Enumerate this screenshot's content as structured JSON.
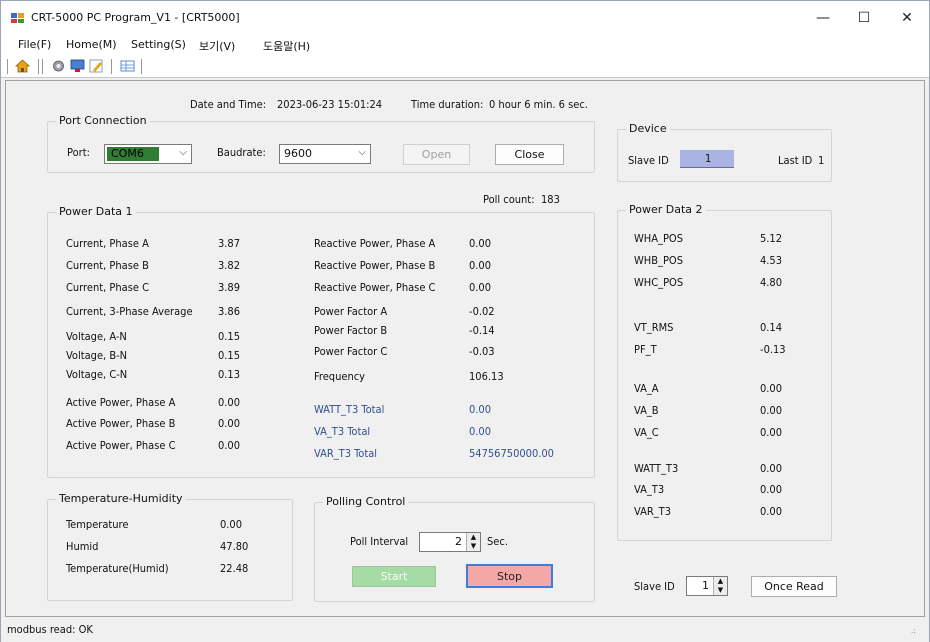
{
  "window": {
    "title": "CRT-5000 PC Program_V1 - [CRT5000]",
    "minimize": "—",
    "maximize": "☐",
    "close": "✕"
  },
  "menu": [
    "File(F)",
    "Home(M)",
    "Setting(S)",
    "보기(V)",
    "도움말(H)"
  ],
  "toolbar": {
    "icons": [
      "home-icon",
      "gear-icon",
      "monitor-icon",
      "edit-icon",
      "table-icon"
    ]
  },
  "header": {
    "datetime_label": "Date and Time:",
    "datetime_value": "2023-06-23 15:01:24",
    "duration_label": "Time duration:",
    "duration_value": "0 hour 6 min. 6 sec."
  },
  "port": {
    "group_title": "Port Connection",
    "port_label": "Port:",
    "port_value": "COM6",
    "baud_label": "Baudrate:",
    "baud_value": "9600",
    "open_label": "Open",
    "close_label": "Close"
  },
  "poll_count": {
    "label": "Poll count:",
    "value": "183"
  },
  "power1": {
    "group_title": "Power Data 1",
    "left": [
      {
        "label": "Current, Phase A",
        "value": "3.87"
      },
      {
        "label": "Current, Phase B",
        "value": "3.82"
      },
      {
        "label": "Current, Phase C",
        "value": "3.89"
      },
      {
        "label": "Current, 3-Phase Average",
        "value": "3.86"
      },
      {
        "label": "Voltage, A-N",
        "value": "0.15"
      },
      {
        "label": "Voltage, B-N",
        "value": "0.15"
      },
      {
        "label": "Voltage, C-N",
        "value": "0.13"
      },
      {
        "label": "Active Power, Phase A",
        "value": "0.00"
      },
      {
        "label": "Active Power, Phase B",
        "value": "0.00"
      },
      {
        "label": "Active Power, Phase C",
        "value": "0.00"
      }
    ],
    "right": [
      {
        "label": "Reactive Power, Phase A",
        "value": "0.00"
      },
      {
        "label": "Reactive Power, Phase B",
        "value": "0.00"
      },
      {
        "label": "Reactive Power, Phase C",
        "value": "0.00"
      },
      {
        "label": "Power Factor A",
        "value": "-0.02"
      },
      {
        "label": "Power Factor B",
        "value": "-0.14"
      },
      {
        "label": "Power Factor C",
        "value": "-0.03"
      },
      {
        "label": "Frequency",
        "value": "106.13"
      },
      {
        "label": "WATT_T3 Total",
        "value": "0.00"
      },
      {
        "label": "VA_T3 Total",
        "value": "0.00"
      },
      {
        "label": "VAR_T3 Total",
        "value": "54756750000.00"
      }
    ]
  },
  "temp": {
    "group_title": "Temperature-Humidity",
    "rows": [
      {
        "label": "Temperature",
        "value": "0.00"
      },
      {
        "label": "Humid",
        "value": "47.80"
      },
      {
        "label": "Temperature(Humid)",
        "value": "22.48"
      }
    ]
  },
  "polling": {
    "group_title": "Polling Control",
    "interval_label": "Poll Interval",
    "interval_value": "2",
    "unit": "Sec.",
    "start_label": "Start",
    "stop_label": "Stop"
  },
  "device": {
    "group_title": "Device",
    "slave_label": "Slave ID",
    "slave_value": "1",
    "last_label": "Last ID",
    "last_value": "1"
  },
  "power2": {
    "group_title": "Power Data 2",
    "rows": [
      {
        "label": "WHA_POS",
        "value": "5.12"
      },
      {
        "label": "WHB_POS",
        "value": "4.53"
      },
      {
        "label": "WHC_POS",
        "value": "4.80"
      },
      {
        "label": "VT_RMS",
        "value": "0.14"
      },
      {
        "label": "PF_T",
        "value": "-0.13"
      },
      {
        "label": "VA_A",
        "value": "0.00"
      },
      {
        "label": "VA_B",
        "value": "0.00"
      },
      {
        "label": "VA_C",
        "value": "0.00"
      },
      {
        "label": "WATT_T3",
        "value": "0.00"
      },
      {
        "label": "VA_T3",
        "value": "0.00"
      },
      {
        "label": "VAR_T3",
        "value": "0.00"
      }
    ]
  },
  "bottom_right": {
    "slave_label": "Slave ID",
    "slave_value": "1",
    "once_label": "Once Read"
  },
  "status": {
    "text": "modbus read: OK"
  },
  "colors": {
    "com_highlight": "#2e7d32",
    "slave_id_box": "#a9b4e4",
    "start_button": "#a5dca5",
    "stop_button": "#f4a7a7",
    "blue_label": "#33508f"
  }
}
